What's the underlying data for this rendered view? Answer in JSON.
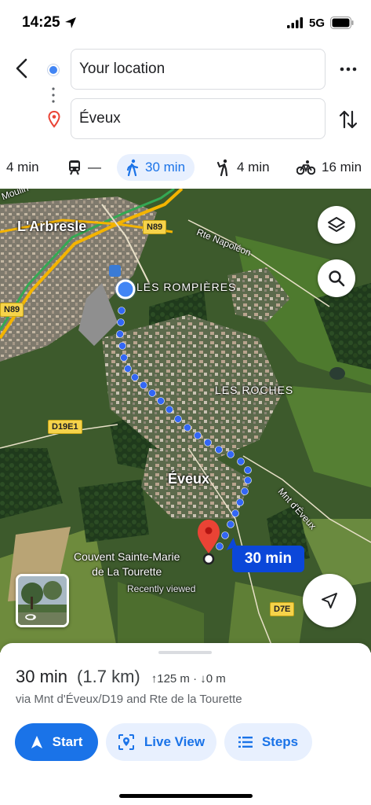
{
  "status_bar": {
    "time": "14:25",
    "network": "5G"
  },
  "directions": {
    "from_value": "Your location",
    "to_value": "Éveux"
  },
  "modes": [
    {
      "name": "drive",
      "label": "4 min"
    },
    {
      "name": "transit",
      "label": "—"
    },
    {
      "name": "walk",
      "label": "30 min",
      "selected": true
    },
    {
      "name": "ride",
      "label": "4 min"
    },
    {
      "name": "bike",
      "label": "16 min"
    }
  ],
  "map": {
    "labels": {
      "arbresle": "L'Arbresle",
      "moulin": "Moulin",
      "rompieres": "LES ROMPIÈRES",
      "roches": "LES ROCHES",
      "eveux": "Éveux",
      "couvent_line1": "Couvent Sainte-Marie",
      "couvent_line2": "de La Tourette",
      "recently_viewed": "Recently viewed",
      "rte_napoleon": "Rte Napoléon",
      "mnt_deveux": "Mnt d'Éveux"
    },
    "road_shields": {
      "n89a": "N89",
      "n89b": "N89",
      "d19e1": "D19E1",
      "d7e": "D7E"
    },
    "eta_bubble": "30 min",
    "route_color": "#3367f5"
  },
  "sheet": {
    "duration": "30 min",
    "distance": "(1.7 km)",
    "elevation": "↑125 m · ↓0 m",
    "via": "via Mnt d'Éveux/D19 and Rte de la Tourette",
    "start_label": "Start",
    "live_view_label": "Live View",
    "steps_label": "Steps"
  },
  "colors": {
    "accent": "#1a73e8",
    "eta_bubble": "#0b47d9",
    "pin": "#ea4335"
  }
}
